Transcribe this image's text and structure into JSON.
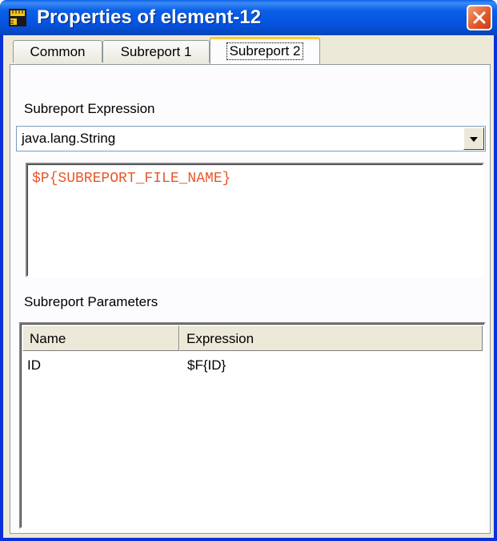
{
  "window": {
    "title": "Properties of element-12"
  },
  "tabs": [
    {
      "label": "Common"
    },
    {
      "label": "Subreport 1"
    },
    {
      "label": "Subreport 2",
      "active": true
    }
  ],
  "subreport_expression": {
    "label": "Subreport Expression",
    "class_value": "java.lang.String",
    "expression": "$P{SUBREPORT_FILE_NAME}"
  },
  "subreport_parameters": {
    "label": "Subreport Parameters",
    "columns": [
      "Name",
      "Expression"
    ],
    "rows": [
      {
        "name": "ID",
        "expression": "$F{ID}"
      }
    ]
  },
  "icons": {
    "app": "ruler-icon",
    "close": "close-icon",
    "dropdown": "chevron-down-icon"
  },
  "colors": {
    "title_bar": "#0553de",
    "close_button": "#e45a2a",
    "expression_text": "#e8582c",
    "active_tab_highlight": "#ffc83c",
    "dialog_bg": "#ece9d8"
  }
}
